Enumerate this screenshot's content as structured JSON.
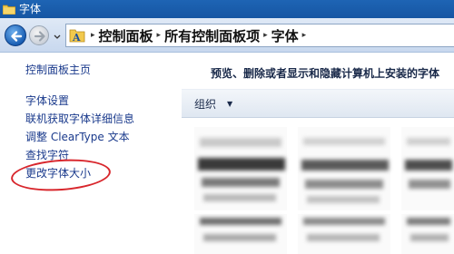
{
  "window": {
    "title": "字体"
  },
  "addressbar": {
    "breadcrumbs": [
      "控制面板",
      "所有控制面板项",
      "字体"
    ]
  },
  "leftnav": {
    "home": "控制面板主页",
    "links": [
      "字体设置",
      "联机获取字体详细信息",
      "调整 ClearType 文本",
      "查找字符",
      "更改字体大小"
    ],
    "highlighted": "更改字体大小"
  },
  "content": {
    "heading": "预览、删除或者显示和隐藏计算机上安装的字体",
    "toolbar": {
      "organize_label": "组织"
    }
  },
  "colors": {
    "title_bar": "#1656a3",
    "link": "#1a3a8c",
    "highlight_circle": "#d8262c"
  }
}
